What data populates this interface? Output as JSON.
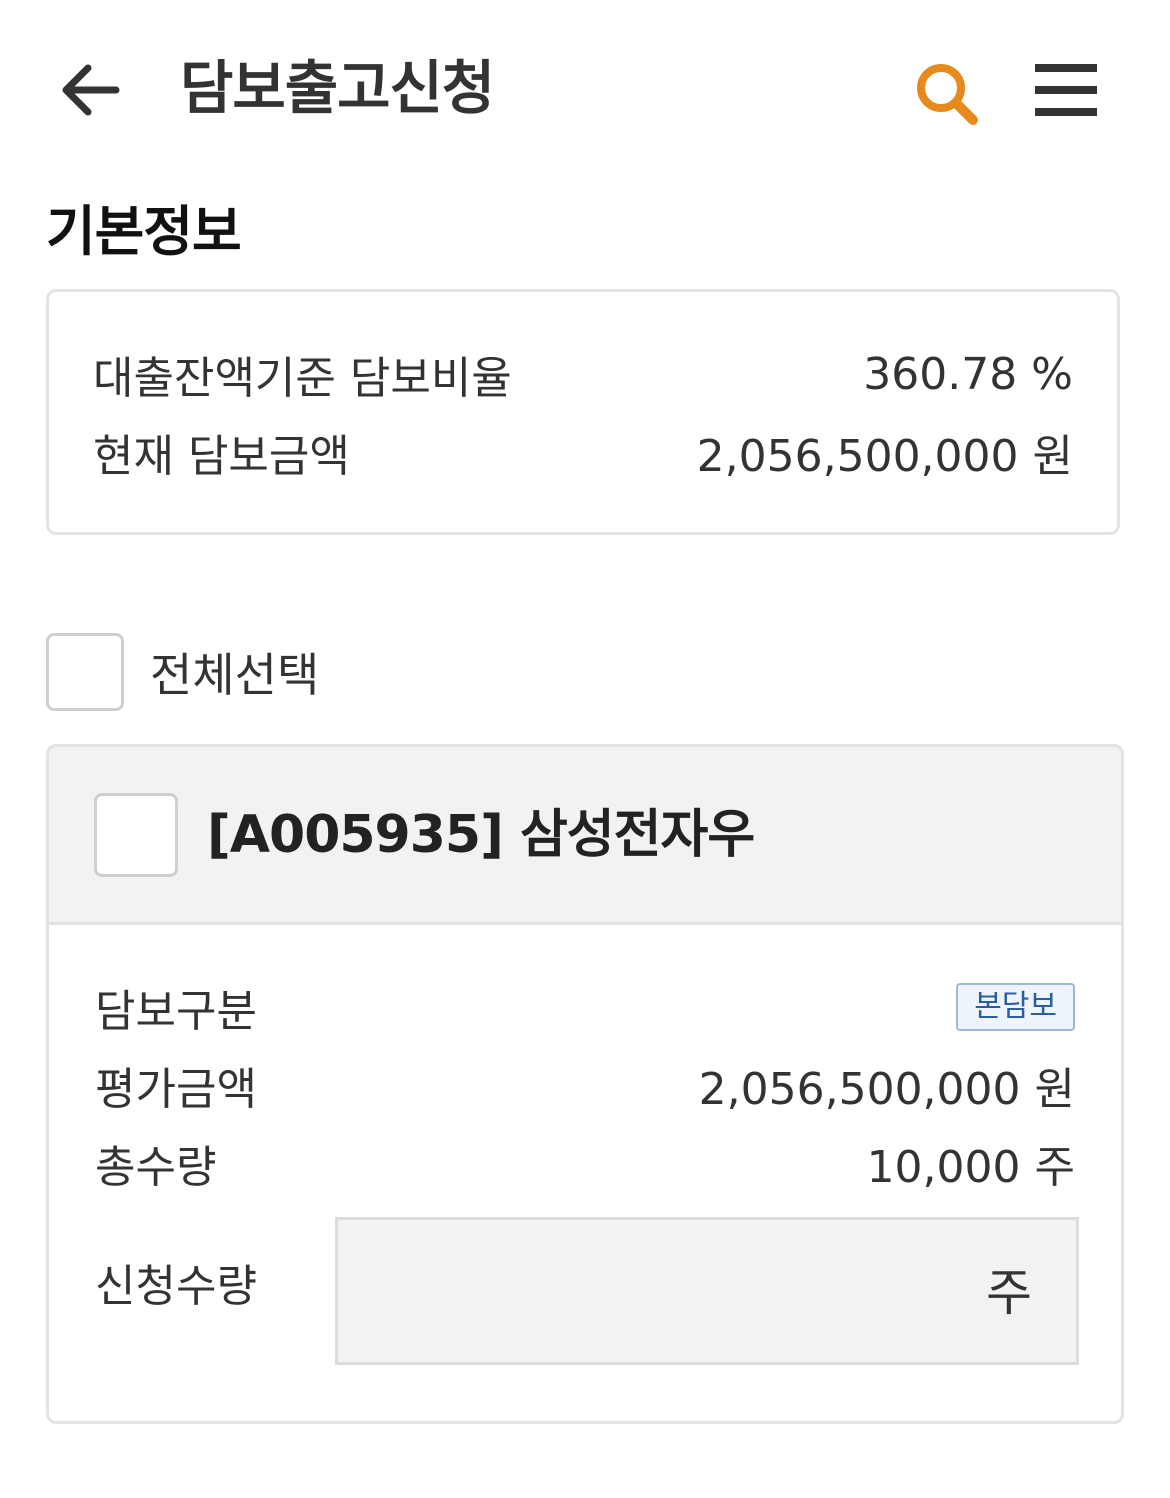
{
  "header": {
    "title": "담보출고신청"
  },
  "colors": {
    "accent": "#e8891c",
    "text": "#333333",
    "border": "#e3e3e3",
    "card_header_bg": "#f1f2f4",
    "badge_text": "#2b5ea0"
  },
  "icons": {
    "back": "arrow-left-icon",
    "search": "search-icon",
    "menu": "hamburger-menu-icon"
  },
  "basic_info": {
    "section_title": "기본정보",
    "ratio_label": "대출잔액기준 담보비율",
    "ratio_value": "360.78 %",
    "amount_label": "현재 담보금액",
    "amount_value": "2,056,500,000 원"
  },
  "select_all": {
    "label": "전체선택",
    "checked": false
  },
  "collateral_item": {
    "name": "[A005935] 삼성전자우",
    "checked": false,
    "type_label": "담보구분",
    "type_badge": "본담보",
    "valuation_label": "평가금액",
    "valuation_value": "2,056,500,000 원",
    "total_qty_label": "총수량",
    "total_qty_value": "10,000 주",
    "request_qty_label": "신청수량",
    "request_qty_value": "",
    "request_qty_unit": "주"
  }
}
